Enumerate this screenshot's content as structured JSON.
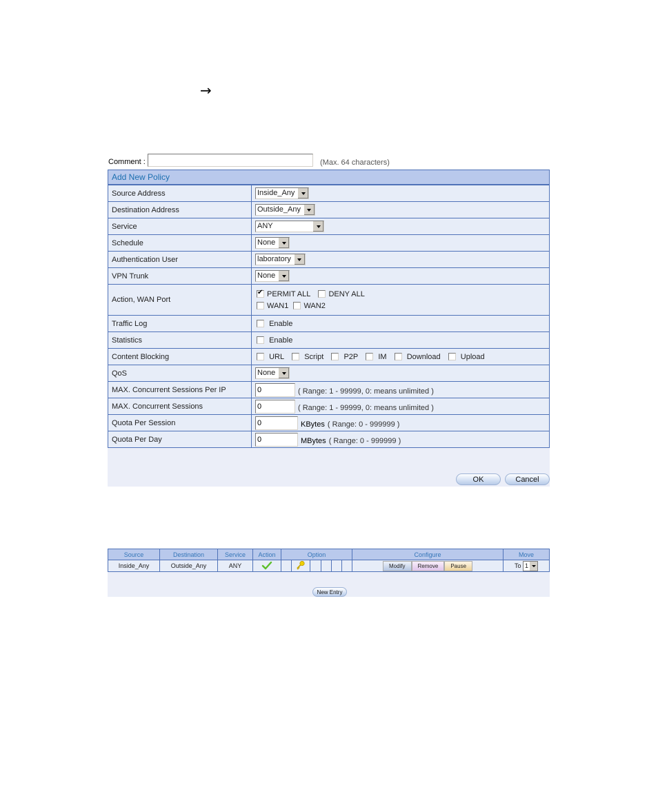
{
  "nav_arrow": "→",
  "add_policy": {
    "comment": {
      "label": "Comment :",
      "value": "",
      "hint": "(Max. 64 characters)"
    },
    "title": "Add New Policy",
    "rows": {
      "source_address": {
        "label": "Source Address",
        "value": "Inside_Any"
      },
      "destination_address": {
        "label": "Destination Address",
        "value": "Outside_Any"
      },
      "service": {
        "label": "Service",
        "value": "ANY"
      },
      "schedule": {
        "label": "Schedule",
        "value": "None"
      },
      "authentication_user": {
        "label": "Authentication User",
        "value": "laboratory"
      },
      "vpn_trunk": {
        "label": "VPN Trunk",
        "value": "None"
      },
      "action_wan": {
        "label": "Action, WAN Port",
        "permit_all": {
          "label": "PERMIT ALL",
          "checked": true
        },
        "deny_all": {
          "label": "DENY ALL",
          "checked": false
        },
        "wan1": {
          "label": "WAN1",
          "checked": false
        },
        "wan2": {
          "label": "WAN2",
          "checked": false
        }
      },
      "traffic_log": {
        "label": "Traffic Log",
        "option": "Enable",
        "checked": false
      },
      "statistics": {
        "label": "Statistics",
        "option": "Enable",
        "checked": false
      },
      "content_blocking": {
        "label": "Content Blocking",
        "options": [
          {
            "label": "URL",
            "checked": false
          },
          {
            "label": "Script",
            "checked": false
          },
          {
            "label": "P2P",
            "checked": false
          },
          {
            "label": "IM",
            "checked": false
          },
          {
            "label": "Download",
            "checked": false
          },
          {
            "label": "Upload",
            "checked": false
          }
        ]
      },
      "qos": {
        "label": "QoS",
        "value": "None"
      },
      "max_sessions_per_ip": {
        "label": "MAX. Concurrent Sessions Per IP",
        "value": "0",
        "hint": "( Range: 1 - 99999, 0: means unlimited )"
      },
      "max_sessions": {
        "label": "MAX. Concurrent Sessions",
        "value": "0",
        "hint": "( Range: 1 - 99999, 0: means unlimited )"
      },
      "quota_per_session": {
        "label": "Quota Per Session",
        "value": "0",
        "unit": "KBytes",
        "hint": "( Range: 0 - 999999 )"
      },
      "quota_per_day": {
        "label": "Quota Per Day",
        "value": "0",
        "unit": "MBytes",
        "hint": "( Range: 0 - 999999 )"
      }
    },
    "buttons": {
      "ok": "OK",
      "cancel": "Cancel"
    }
  },
  "policy_list": {
    "headers": {
      "source": "Source",
      "destination": "Destination",
      "service": "Service",
      "action": "Action",
      "option": "Option",
      "configure": "Configure",
      "move": "Move"
    },
    "rows": [
      {
        "source": "Inside_Any",
        "destination": "Outside_Any",
        "service": "ANY",
        "action": "permit",
        "options": [
          "",
          "key",
          "",
          "",
          "",
          ""
        ],
        "configure": {
          "modify": "Modify",
          "remove": "Remove",
          "pause": "Pause"
        },
        "move": {
          "prefix": "To",
          "value": "1"
        }
      }
    ],
    "new_entry": "New Entry"
  }
}
